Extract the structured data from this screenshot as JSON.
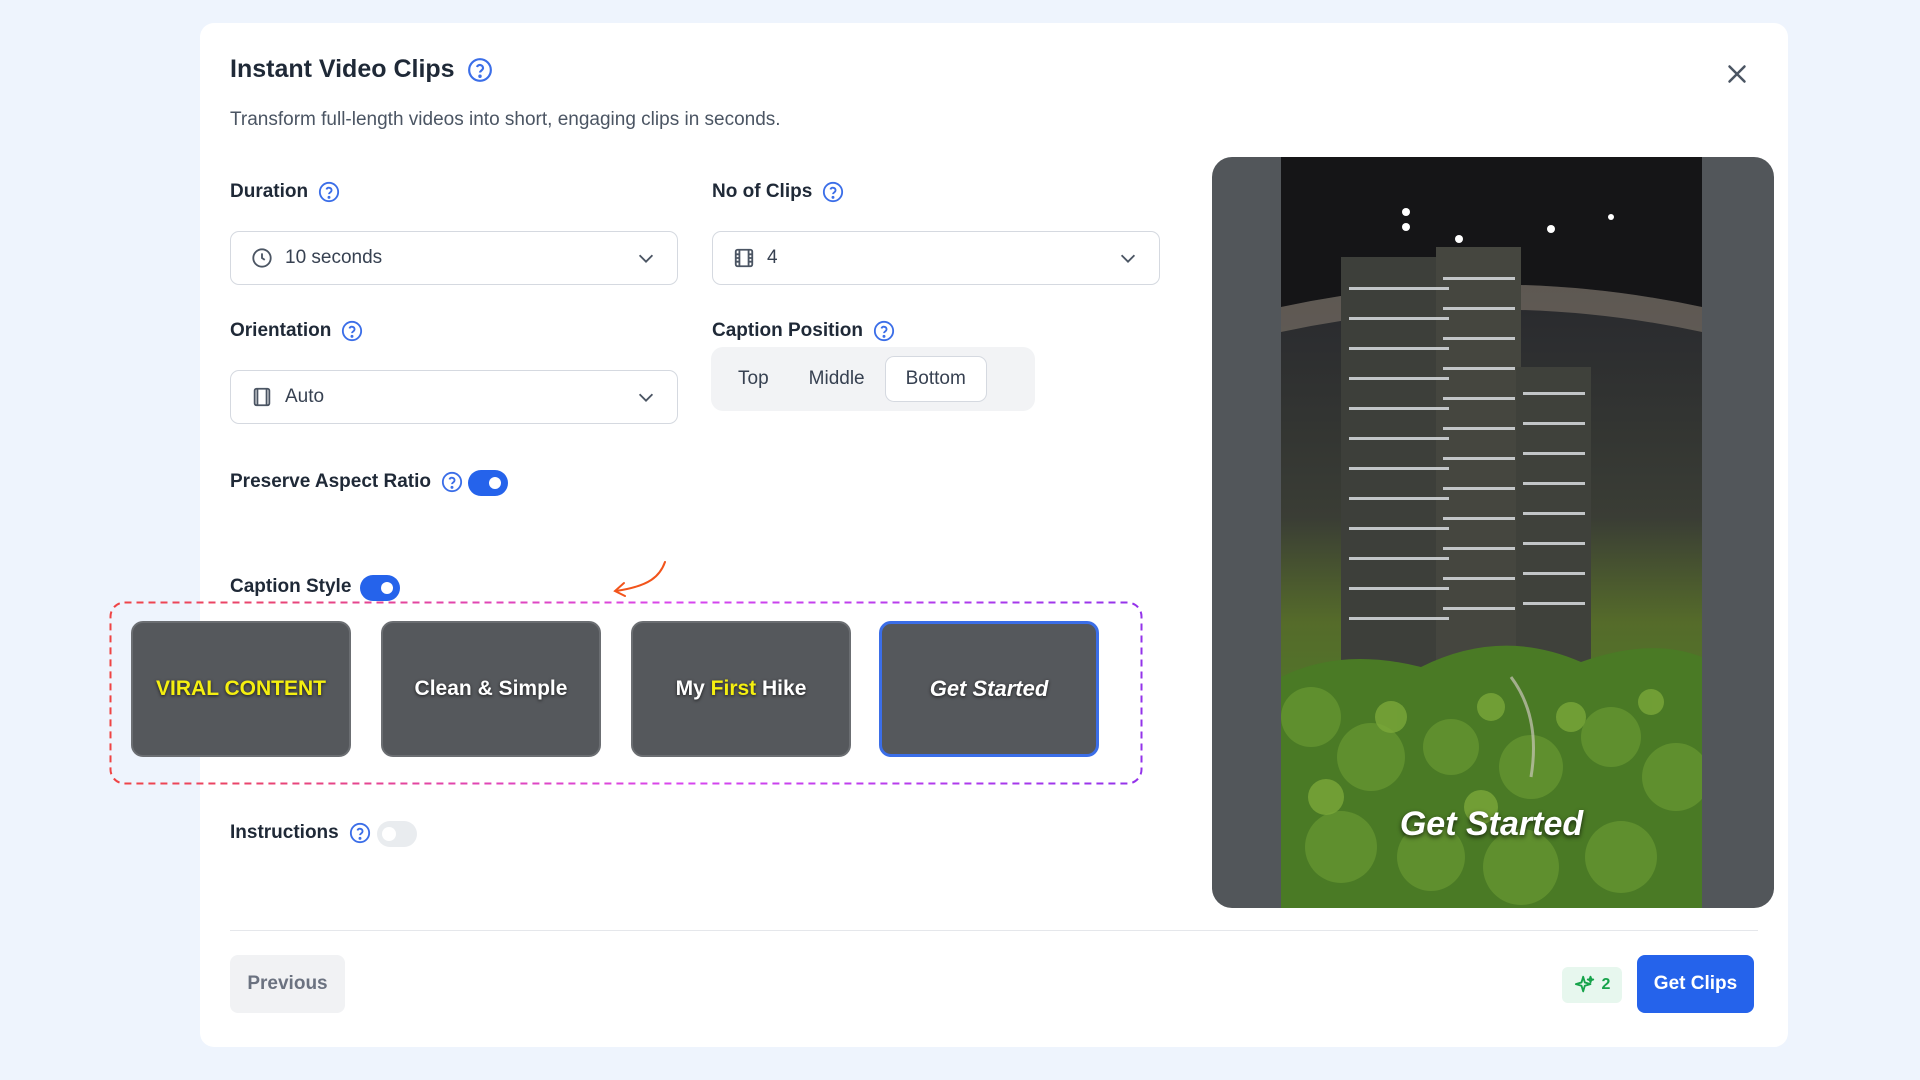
{
  "modal": {
    "title": "Instant Video Clips",
    "subtitle": "Transform full-length videos into short, engaging clips in seconds."
  },
  "duration": {
    "label": "Duration",
    "value": "10 seconds",
    "icon": "clock-icon"
  },
  "clips": {
    "label": "No of Clips",
    "value": "4",
    "icon": "film-icon"
  },
  "orientation": {
    "label": "Orientation",
    "value": "Auto",
    "icon": "orientation-icon"
  },
  "caption_position": {
    "label": "Caption Position",
    "options": [
      "Top",
      "Middle",
      "Bottom"
    ],
    "selected": "Bottom"
  },
  "preserve_aspect_ratio": {
    "label": "Preserve Aspect Ratio",
    "enabled": true
  },
  "caption_style": {
    "label": "Caption Style",
    "enabled": true,
    "styles": [
      {
        "text": "VIRAL CONTENT"
      },
      {
        "text": "Clean & Simple"
      },
      {
        "pre": "My",
        "highlight": "First",
        "post": "Hike"
      },
      {
        "text": "Get Started"
      }
    ],
    "selected_index": 3
  },
  "instructions": {
    "label": "Instructions",
    "enabled": false
  },
  "preview": {
    "caption": "Get Started"
  },
  "footer": {
    "previous": "Previous",
    "credits": "2",
    "get_clips": "Get Clips"
  },
  "colors": {
    "accent": "#2563eb",
    "highlight": "#f5ef10",
    "annotation": "#f2541b"
  }
}
